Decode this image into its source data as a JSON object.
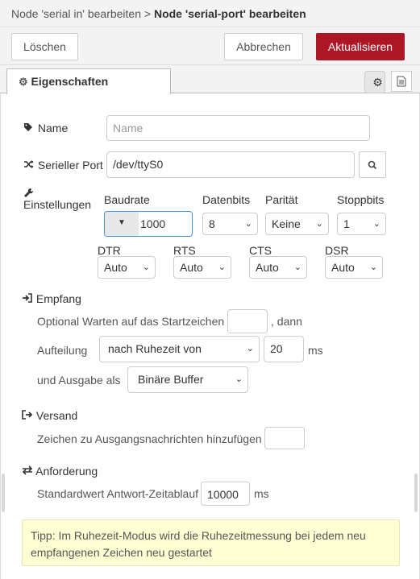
{
  "header": {
    "breadcrumb_parent": "Node 'serial in' bearbeiten",
    "separator": ">",
    "title": "Node 'serial-port' bearbeiten"
  },
  "toolbar": {
    "delete_label": "Löschen",
    "cancel_label": "Abbrechen",
    "update_label": "Aktualisieren",
    "accent_color": "#AD1625"
  },
  "tabs": {
    "properties_label": "Eigenschaften",
    "icons": [
      "gear-icon",
      "document-icon"
    ]
  },
  "form": {
    "name": {
      "label": "Name",
      "placeholder": "Name",
      "value": ""
    },
    "port": {
      "label": "Serieller Port",
      "value": "/dev/ttyS0"
    },
    "settings": {
      "label": "Einstellungen",
      "baud": {
        "label": "Baudrate",
        "value": "1000"
      },
      "databits": {
        "label": "Datenbits",
        "value": "8"
      },
      "parity": {
        "label": "Parität",
        "value": "Keine"
      },
      "stopbits": {
        "label": "Stoppbits",
        "value": "1"
      },
      "dtr": {
        "label": "DTR",
        "value": "Auto"
      },
      "rts": {
        "label": "RTS",
        "value": "Auto"
      },
      "cts": {
        "label": "CTS",
        "value": "Auto"
      },
      "dsr": {
        "label": "DSR",
        "value": "Auto"
      }
    },
    "input": {
      "label": "Empfang",
      "wait_label": "Optional Warten auf das Startzeichen",
      "wait_suffix": ", dann",
      "wait_value": "",
      "split_label": "Aufteilung",
      "split_value": "nach Ruhezeit von",
      "split_amount": "20",
      "split_unit": "ms",
      "output_label": "und Ausgabe als",
      "output_value": "Binäre Buffer"
    },
    "output": {
      "label": "Versand",
      "add_char_label": "Zeichen zu Ausgangsnachrichten hinzufügen",
      "add_char_value": ""
    },
    "request": {
      "label": "Anforderung",
      "timeout_label": "Standardwert Antwort-Zeitablauf",
      "timeout_value": "10000",
      "timeout_unit": "ms"
    },
    "tip": "Tipp: Im Ruhezeit-Modus wird die Ruhezeitmessung bei jedem neu empfangenen Zeichen neu gestartet"
  }
}
